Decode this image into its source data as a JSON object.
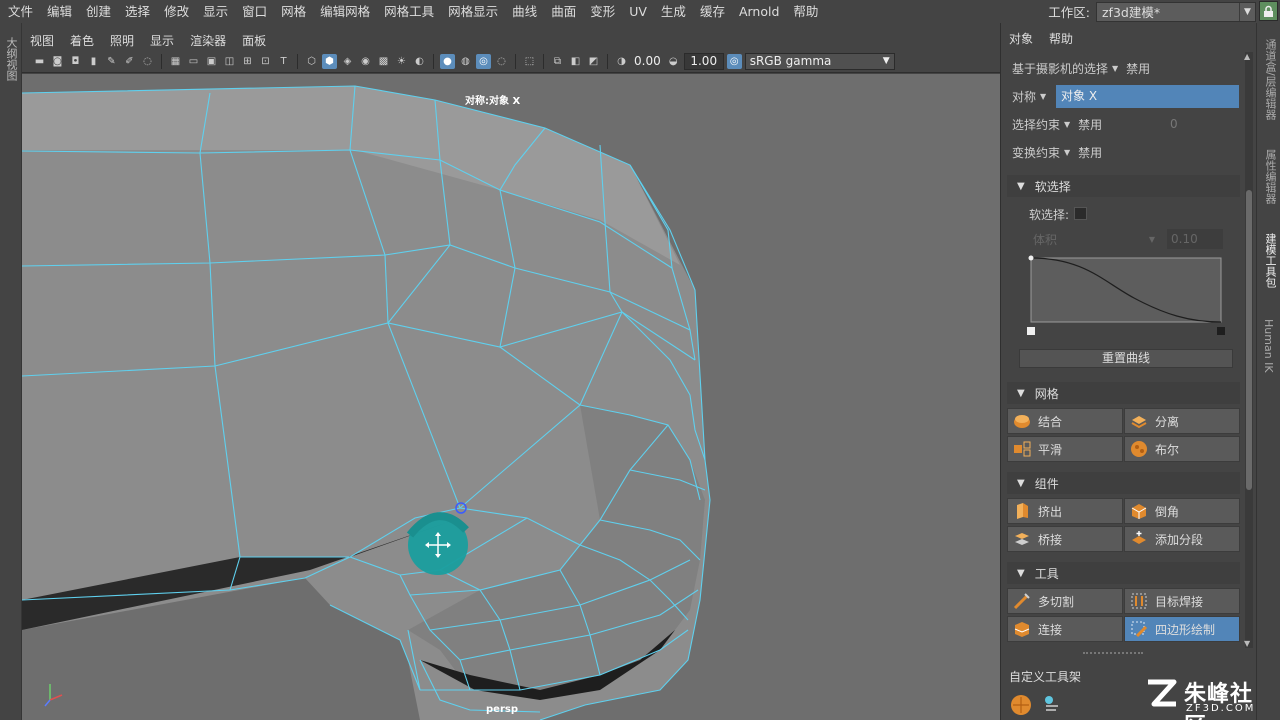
{
  "menubar": {
    "items": [
      "文件",
      "编辑",
      "创建",
      "选择",
      "修改",
      "显示",
      "窗口",
      "网格",
      "编辑网格",
      "网格工具",
      "网格显示",
      "曲线",
      "曲面",
      "变形",
      "UV",
      "生成",
      "缓存",
      "Arnold",
      "帮助"
    ],
    "workspace_label": "工作区:",
    "workspace_value": "zf3d建模*"
  },
  "left_strip": {
    "label": "大纲视图"
  },
  "viewport": {
    "menu": [
      "视图",
      "着色",
      "照明",
      "显示",
      "渲染器",
      "面板"
    ],
    "exposure": "0.00",
    "gamma": "1.00",
    "color_space": "sRGB gamma",
    "overlay_title": "对称:对象 X",
    "camera": "persp"
  },
  "right_panel": {
    "tabs": [
      "对象",
      "帮助"
    ],
    "camera_select": {
      "label": "基于摄影机的选择",
      "value": "禁用"
    },
    "symmetry": {
      "label": "对称",
      "value": "对象 X"
    },
    "select_constraint": {
      "label": "选择约束",
      "value": "禁用",
      "number": "0"
    },
    "transform_constraint": {
      "label": "变换约束",
      "value": "禁用"
    },
    "soft_select": {
      "title": "软选择",
      "checkbox_label": "软选择:",
      "mode": "体积",
      "falloff": "0.10",
      "reset_label": "重置曲线"
    },
    "mesh": {
      "title": "网格",
      "buttons": [
        "结合",
        "分离",
        "平滑",
        "布尔"
      ]
    },
    "components": {
      "title": "组件",
      "buttons": [
        "挤出",
        "倒角",
        "桥接",
        "添加分段"
      ]
    },
    "tools": {
      "title": "工具",
      "buttons": [
        "多切割",
        "目标焊接",
        "连接",
        "四边形绘制"
      ],
      "active": "四边形绘制"
    },
    "custom_shelf": "自定义工具架"
  },
  "right_strip": {
    "tabs": [
      "通道盒/层编辑器",
      "属性编辑器",
      "建模工具包",
      "Human IK"
    ],
    "active": "建模工具包"
  },
  "watermark": {
    "cn": "朱峰社区",
    "en": "ZF3D.COM"
  },
  "colors": {
    "wire": "#5fd0ee",
    "accent": "#5285b8",
    "brush": "#1a9e9e",
    "mesh": "#8f8f8f"
  }
}
